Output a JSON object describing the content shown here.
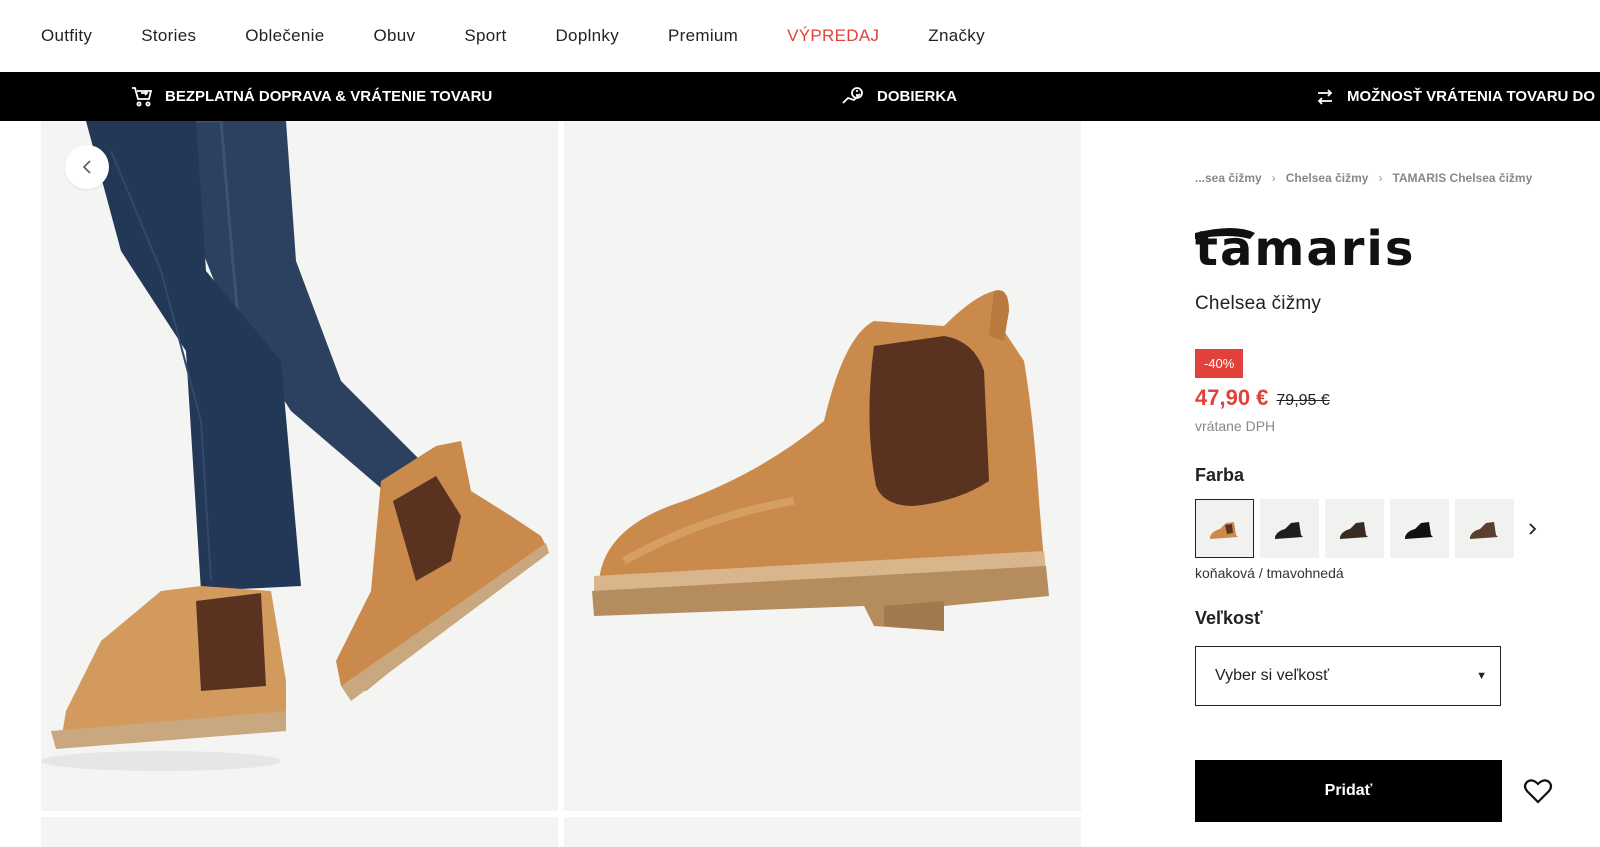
{
  "nav": {
    "items": [
      {
        "label": "Outfity",
        "sale": false
      },
      {
        "label": "Stories",
        "sale": false
      },
      {
        "label": "Oblečenie",
        "sale": false
      },
      {
        "label": "Obuv",
        "sale": false
      },
      {
        "label": "Sport",
        "sale": false
      },
      {
        "label": "Doplnky",
        "sale": false
      },
      {
        "label": "Premium",
        "sale": false
      },
      {
        "label": "VÝPREDAJ",
        "sale": true
      },
      {
        "label": "Značky",
        "sale": false
      }
    ]
  },
  "promo": {
    "shipping": {
      "icon": "cart-return-icon",
      "text": "BEZPLATNÁ DOPRAVA & VRÁTENIE TOVARU"
    },
    "cod": {
      "icon": "cash-hand-icon",
      "text": "DOBIERKA"
    },
    "returns": {
      "icon": "swap-arrows-icon",
      "text": "MOŽNOSŤ VRÁTENIA TOVARU DO"
    }
  },
  "breadcrumb": [
    "...sea čižmy",
    "Chelsea čižmy",
    "TAMARIS Chelsea čižmy"
  ],
  "product": {
    "brand": "Tamaris",
    "name": "Chelsea čižmy",
    "discount": "-40%",
    "price": "47,90 €",
    "old_price": "79,95 €",
    "vat_note": "vrátane DPH"
  },
  "color": {
    "label": "Farba",
    "selected_name": "koňaková / tmavohnedá",
    "swatches": [
      {
        "color": "#c98a4b",
        "selected": true
      },
      {
        "color": "#1e1e1e",
        "selected": false
      },
      {
        "color": "#3a2a22",
        "selected": false
      },
      {
        "color": "#111111",
        "selected": false
      },
      {
        "color": "#5a3f2e",
        "selected": false
      }
    ]
  },
  "size": {
    "label": "Veľkosť",
    "placeholder": "Vyber si veľkosť"
  },
  "actions": {
    "add_label": "Pridať"
  },
  "colors": {
    "sale_red": "#e0413a",
    "boot_tan": "#c98a4b",
    "elastic_brown": "#5a3320",
    "denim": "#2a3f5f"
  }
}
